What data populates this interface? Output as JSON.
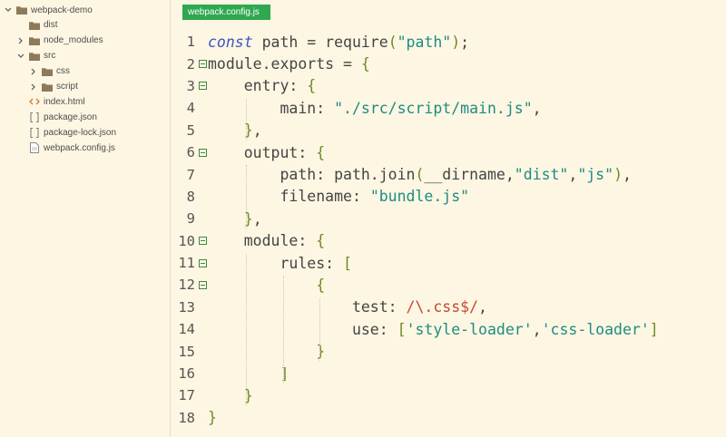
{
  "explorer": {
    "items": [
      {
        "label": "webpack-demo",
        "type": "folder",
        "expanded": true,
        "depth": 0
      },
      {
        "label": "dist",
        "type": "folder",
        "expanded": false,
        "depth": 1,
        "chevron": false
      },
      {
        "label": "node_modules",
        "type": "folder",
        "expanded": false,
        "depth": 1
      },
      {
        "label": "src",
        "type": "folder",
        "expanded": true,
        "depth": 1
      },
      {
        "label": "css",
        "type": "folder",
        "expanded": false,
        "depth": 2
      },
      {
        "label": "script",
        "type": "folder",
        "expanded": false,
        "depth": 2
      },
      {
        "label": "index.html",
        "type": "html",
        "depth": 1
      },
      {
        "label": "package.json",
        "type": "json",
        "depth": 1
      },
      {
        "label": "package-lock.json",
        "type": "json",
        "depth": 1
      },
      {
        "label": "webpack.config.js",
        "type": "js",
        "depth": 1
      }
    ]
  },
  "editor": {
    "tab_label": "webpack.config.js",
    "lines": [
      {
        "n": "1",
        "fold": false,
        "tokens": [
          [
            "kw",
            "const"
          ],
          [
            "p",
            " path = require("
          ],
          [
            "str",
            "\"path\""
          ],
          [
            "p",
            ");"
          ]
        ]
      },
      {
        "n": "2",
        "fold": true,
        "tokens": [
          [
            "p",
            "module.exports = {"
          ]
        ]
      },
      {
        "n": "3",
        "fold": true,
        "tokens": [
          [
            "p",
            "    entry: {"
          ]
        ]
      },
      {
        "n": "4",
        "fold": false,
        "tokens": [
          [
            "p",
            "        main: "
          ],
          [
            "str",
            "\"./src/script/main.js\""
          ],
          [
            "p",
            ","
          ]
        ]
      },
      {
        "n": "5",
        "fold": false,
        "tokens": [
          [
            "p",
            "    },"
          ]
        ]
      },
      {
        "n": "6",
        "fold": true,
        "tokens": [
          [
            "p",
            "    output: {"
          ]
        ]
      },
      {
        "n": "7",
        "fold": false,
        "tokens": [
          [
            "p",
            "        path: path.join(__dirname,"
          ],
          [
            "str",
            "\"dist\""
          ],
          [
            "p",
            ","
          ],
          [
            "str",
            "\"js\""
          ],
          [
            "p",
            "),"
          ]
        ]
      },
      {
        "n": "8",
        "fold": false,
        "tokens": [
          [
            "p",
            "        filename: "
          ],
          [
            "str",
            "\"bundle.js\""
          ]
        ]
      },
      {
        "n": "9",
        "fold": false,
        "tokens": [
          [
            "p",
            "    },"
          ]
        ]
      },
      {
        "n": "10",
        "fold": true,
        "tokens": [
          [
            "p",
            "    module: {"
          ]
        ]
      },
      {
        "n": "11",
        "fold": true,
        "tokens": [
          [
            "p",
            "        rules: ["
          ]
        ]
      },
      {
        "n": "12",
        "fold": true,
        "tokens": [
          [
            "p",
            "            {"
          ]
        ]
      },
      {
        "n": "13",
        "fold": false,
        "tokens": [
          [
            "p",
            "                test: "
          ],
          [
            "re",
            "/\\.css$/"
          ],
          [
            "p",
            ","
          ]
        ]
      },
      {
        "n": "14",
        "fold": false,
        "tokens": [
          [
            "p",
            "                use: ["
          ],
          [
            "str",
            "'style-loader'"
          ],
          [
            "p",
            ","
          ],
          [
            "str",
            "'css-loader'"
          ],
          [
            "p",
            "]"
          ]
        ]
      },
      {
        "n": "15",
        "fold": false,
        "tokens": [
          [
            "p",
            "            }"
          ]
        ]
      },
      {
        "n": "16",
        "fold": false,
        "tokens": [
          [
            "p",
            "        ]"
          ]
        ]
      },
      {
        "n": "17",
        "fold": false,
        "tokens": [
          [
            "p",
            "    }"
          ]
        ]
      },
      {
        "n": "18",
        "fold": false,
        "tokens": [
          [
            "p",
            "}"
          ]
        ]
      }
    ]
  },
  "colors": {
    "background": "#fdf6e3",
    "tab_active": "#2fa84f",
    "keyword": "#3b57c4",
    "string": "#1e8c82",
    "regex": "#c34b2c",
    "punctuation": "#6e8a26",
    "folder_icon": "#8c7a5a"
  },
  "icons": {
    "chevron_expanded": "chevron-down-icon",
    "chevron_collapsed": "chevron-right-icon",
    "folder": "folder-icon",
    "html": "html-file-icon",
    "json": "json-file-icon",
    "js": "js-file-icon",
    "fold": "fold-minus-icon"
  }
}
